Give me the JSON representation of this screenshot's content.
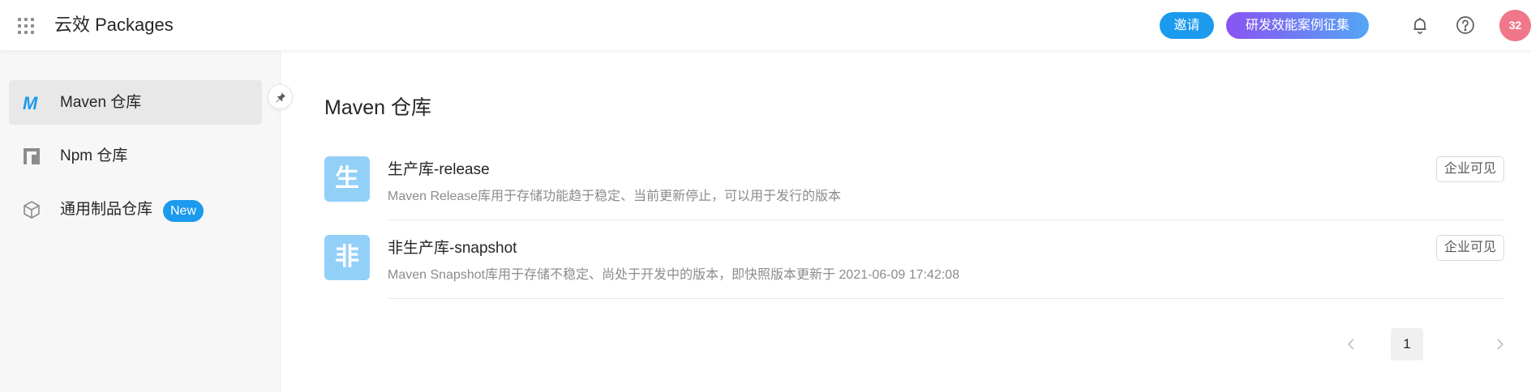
{
  "header": {
    "app_title": "云效 Packages",
    "invite_label": "邀请",
    "campaign_label": "研发效能案例征集",
    "avatar_text": "32"
  },
  "sidebar": {
    "items": [
      {
        "label": "Maven 仓库",
        "icon": "maven-icon",
        "active": true
      },
      {
        "label": "Npm 仓库",
        "icon": "npm-icon",
        "active": false
      },
      {
        "label": "通用制品仓库",
        "icon": "cube-icon",
        "active": false,
        "badge": "New"
      }
    ]
  },
  "main": {
    "title": "Maven 仓库",
    "repos": [
      {
        "icon_char": "生",
        "name": "生产库-release",
        "description": "Maven Release库用于存储功能趋于稳定、当前更新停止，可以用于发行的版本",
        "visibility": "企业可见"
      },
      {
        "icon_char": "非",
        "name": "非生产库-snapshot",
        "description": "Maven Snapshot库用于存储不稳定、尚处于开发中的版本，即快照版本更新于 2021-06-09 17:42:08",
        "visibility": "企业可见"
      }
    ],
    "pagination": {
      "current_page": "1"
    }
  },
  "colors": {
    "accent": "#1b9aee",
    "campaign_gradient_start": "#8a53f2",
    "campaign_gradient_end": "#54a6f5",
    "avatar": "#f0778a",
    "repo_icon": "#92d0f8"
  }
}
